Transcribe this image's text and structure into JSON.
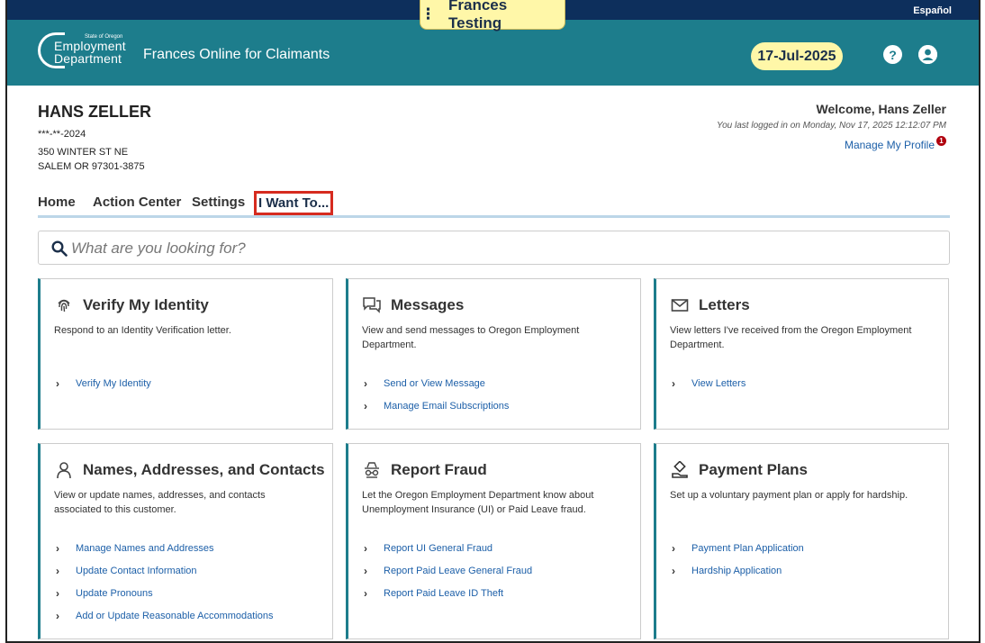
{
  "banner": {
    "label": "Frances Testing",
    "language_link": "Español"
  },
  "header": {
    "logo": {
      "state": "State of Oregon",
      "line1": "Employment",
      "line2": "Department"
    },
    "app_title": "Frances Online for Claimants",
    "date": "17-Jul-2025",
    "help_glyph": "?",
    "user_glyph": "●"
  },
  "customer": {
    "name": "HANS ZELLER",
    "ssn": "***-**-2024",
    "address_line1": "350 WINTER ST NE",
    "address_line2": "SALEM OR 97301-3875"
  },
  "account": {
    "welcome": "Welcome, Hans Zeller",
    "last_login": "You last logged in on Monday, Nov 17, 2025 12:12:07 PM",
    "manage_profile": "Manage My Profile",
    "notification_count": "1"
  },
  "nav": {
    "tabs": [
      {
        "label": "Home"
      },
      {
        "label": "Action Center"
      },
      {
        "label": "Settings"
      },
      {
        "label": "I Want To..."
      }
    ],
    "active_index": 3
  },
  "search": {
    "placeholder": "What are you looking for?",
    "value": ""
  },
  "cards": [
    {
      "title": "Verify My Identity",
      "icon": "fingerprint-icon",
      "description": "Respond to an Identity Verification letter.",
      "links": [
        "Verify My Identity"
      ]
    },
    {
      "title": "Messages",
      "icon": "chat-icon",
      "description": "View and send messages to Oregon Employment Department.",
      "links": [
        "Send or View Message",
        "Manage Email Subscriptions"
      ]
    },
    {
      "title": "Letters",
      "icon": "envelope-icon",
      "description": "View letters I've received from the Oregon Employment Department.",
      "links": [
        "View Letters"
      ]
    },
    {
      "title": "Names, Addresses, and Contacts",
      "icon": "person-icon",
      "description": "View or update names, addresses, and contacts associated to this customer.",
      "links": [
        "Manage Names and Addresses",
        "Update Contact Information",
        "Update Pronouns",
        "Add or Update Reasonable Accommodations"
      ]
    },
    {
      "title": "Report Fraud",
      "icon": "spy-icon",
      "description": "Let the Oregon Employment Department know about Unemployment Insurance (UI) or Paid Leave fraud.",
      "links": [
        "Report UI General Fraud",
        "Report Paid Leave General Fraud",
        "Report Paid Leave ID Theft"
      ]
    },
    {
      "title": "Payment Plans",
      "icon": "hand-money-icon",
      "description": "Set up a voluntary payment plan or apply for hardship.",
      "links": [
        "Payment Plan Application",
        "Hardship Application"
      ]
    }
  ],
  "colors": {
    "header": "#1d7d8c",
    "topstrip": "#0d2f5c",
    "highlight": "#fff7a8",
    "link": "#1c5fa8",
    "active_outline": "#d62b1f"
  }
}
